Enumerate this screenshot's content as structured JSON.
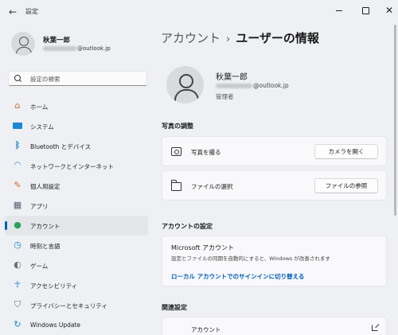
{
  "window": {
    "title": "設定"
  },
  "sidebar": {
    "user": {
      "name": "秋葉一郎",
      "email_domain": "@outlook.jp"
    },
    "search": {
      "placeholder": "設定の検索"
    },
    "items": [
      {
        "label": "ホーム",
        "icon": "home-icon",
        "color": "#c46a34"
      },
      {
        "label": "システム",
        "icon": "system-icon",
        "color": "#1b86d6"
      },
      {
        "label": "Bluetooth とデバイス",
        "icon": "bluetooth-icon",
        "color": "#1b86d6"
      },
      {
        "label": "ネットワークとインターネット",
        "icon": "wifi-icon",
        "color": "#1b86d6"
      },
      {
        "label": "個人用設定",
        "icon": "brush-icon",
        "color": "#d9702c"
      },
      {
        "label": "アプリ",
        "icon": "apps-icon",
        "color": "#5a6170"
      },
      {
        "label": "アカウント",
        "icon": "account-icon",
        "color": "#2aa35b"
      },
      {
        "label": "時刻と言語",
        "icon": "clock-globe-icon",
        "color": "#1b86d6"
      },
      {
        "label": "ゲーム",
        "icon": "gamepad-icon",
        "color": "#6d717a"
      },
      {
        "label": "アクセシビリティ",
        "icon": "accessibility-icon",
        "color": "#1b86d6"
      },
      {
        "label": "プライバシーとセキュリティ",
        "icon": "shield-icon",
        "color": "#6d717a"
      },
      {
        "label": "Windows Update",
        "icon": "update-icon",
        "color": "#1b86d6"
      }
    ],
    "active_index": 6
  },
  "main": {
    "breadcrumb": {
      "parent": "アカウント",
      "separator": "›",
      "current": "ユーザーの情報"
    },
    "profile": {
      "name": "秋葉一郎",
      "email_domain": "@outlook.jp",
      "role": "管理者"
    },
    "photo_section": {
      "title": "写真の調整",
      "rows": [
        {
          "label": "写真を撮る",
          "button": "カメラを開く",
          "icon": "camera-icon"
        },
        {
          "label": "ファイルの選択",
          "button": "ファイルの参照",
          "icon": "folder-icon"
        }
      ]
    },
    "account_section": {
      "title": "アカウントの設定",
      "ms_title": "Microsoft アカウント",
      "ms_desc": "設定とファイルの同期を自動的にすると、Windows が改善されます",
      "link": "ローカル アカウントでのサインインに切り替える"
    },
    "related_section": {
      "title": "関連設定",
      "item": "アカウント"
    }
  },
  "colors": {
    "accent": "#005fb8",
    "background": "#eef0f4",
    "card": "#f9f9fb"
  }
}
